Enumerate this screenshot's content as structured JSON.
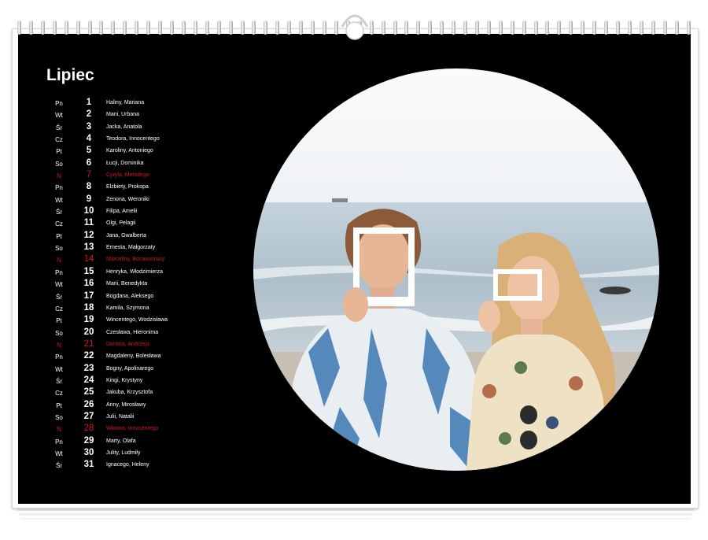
{
  "calendar": {
    "month": "Lipiec",
    "days": [
      {
        "dow": "Pn",
        "num": "1",
        "names": "Haliny, Mariana",
        "sunday": false
      },
      {
        "dow": "Wt",
        "num": "2",
        "names": "Mani, Urbana",
        "sunday": false
      },
      {
        "dow": "Śr",
        "num": "3",
        "names": "Jacka, Anatola",
        "sunday": false
      },
      {
        "dow": "Cz",
        "num": "4",
        "names": "Teodora, Innocentego",
        "sunday": false
      },
      {
        "dow": "Pt",
        "num": "5",
        "names": "Karoliny, Antoniego",
        "sunday": false
      },
      {
        "dow": "So",
        "num": "6",
        "names": "Łucji, Dominika",
        "sunday": false
      },
      {
        "dow": "N",
        "num": "7",
        "names": "Cyryla, Metodego",
        "sunday": true
      },
      {
        "dow": "Pn",
        "num": "8",
        "names": "Elżbiety, Prokopa",
        "sunday": false
      },
      {
        "dow": "Wt",
        "num": "9",
        "names": "Zenona, Weroniki",
        "sunday": false
      },
      {
        "dow": "Śr",
        "num": "10",
        "names": "Filipa, Amelii",
        "sunday": false
      },
      {
        "dow": "Cz",
        "num": "11",
        "names": "Olgi, Pelagii",
        "sunday": false
      },
      {
        "dow": "Pt",
        "num": "12",
        "names": "Jana, Gwalberta",
        "sunday": false
      },
      {
        "dow": "So",
        "num": "13",
        "names": "Ernesta, Małgorzaty",
        "sunday": false
      },
      {
        "dow": "N",
        "num": "14",
        "names": "Marceliny, Bonawentury",
        "sunday": true
      },
      {
        "dow": "Pn",
        "num": "15",
        "names": "Henryka, Włodzimierza",
        "sunday": false
      },
      {
        "dow": "Wt",
        "num": "16",
        "names": "Marii, Benedykta",
        "sunday": false
      },
      {
        "dow": "Śr",
        "num": "17",
        "names": "Bogdana, Aleksego",
        "sunday": false
      },
      {
        "dow": "Cz",
        "num": "18",
        "names": "Kamila, Szymona",
        "sunday": false
      },
      {
        "dow": "Pt",
        "num": "19",
        "names": "Wincentego, Wodzisława",
        "sunday": false
      },
      {
        "dow": "So",
        "num": "20",
        "names": "Czesława, Hieronima",
        "sunday": false
      },
      {
        "dow": "N",
        "num": "21",
        "names": "Daniela, Andrzeja",
        "sunday": true
      },
      {
        "dow": "Pn",
        "num": "22",
        "names": "Magdaleny, Bolesława",
        "sunday": false
      },
      {
        "dow": "Wt",
        "num": "23",
        "names": "Bogny, Apolinarego",
        "sunday": false
      },
      {
        "dow": "Śr",
        "num": "24",
        "names": "Kingi, Krystyny",
        "sunday": false
      },
      {
        "dow": "Cz",
        "num": "25",
        "names": "Jakuba, Krzysztofa",
        "sunday": false
      },
      {
        "dow": "Pt",
        "num": "26",
        "names": "Anny, Mirosławy",
        "sunday": false
      },
      {
        "dow": "So",
        "num": "27",
        "names": "Julii, Natalii",
        "sunday": false
      },
      {
        "dow": "N",
        "num": "28",
        "names": "Wiktora, Innocentego",
        "sunday": true
      },
      {
        "dow": "Pn",
        "num": "29",
        "names": "Marty, Olafa",
        "sunday": false
      },
      {
        "dow": "Wt",
        "num": "30",
        "names": "Julity, Ludmiły",
        "sunday": false
      },
      {
        "dow": "Śr",
        "num": "31",
        "names": "Ignacego, Heleny",
        "sunday": false
      }
    ]
  },
  "colors": {
    "background": "#000000",
    "text": "#ffffff",
    "sunday": "#d0101a"
  },
  "photo": {
    "icon": "beach-photo-two-women-icon"
  }
}
